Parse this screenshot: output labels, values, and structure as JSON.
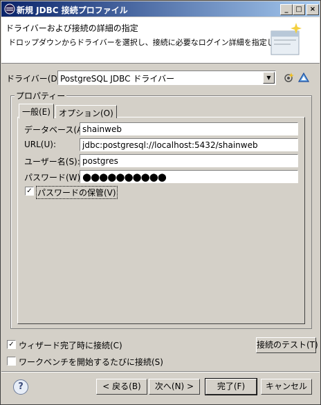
{
  "window": {
    "title": "新規 JDBC 接続プロファイル",
    "controls": {
      "minimize": "_",
      "maximize": "□",
      "close": "×"
    }
  },
  "banner": {
    "title": "ドライバーおよび接続の詳細の指定",
    "description": "ドロップダウンからドライバーを選択し、接続に必要なログイン詳細を指定します。",
    "icon": "wizard-banner-icon"
  },
  "driver": {
    "label": "ドライバー(D):",
    "selected": "PostgreSQL JDBC ドライバー",
    "icons": [
      "new-driver-icon",
      "edit-driver-icon"
    ]
  },
  "properties": {
    "group_label": "プロパティー",
    "tabs": [
      {
        "label": "一般(E)",
        "selected": true
      },
      {
        "label": "オプション(O)",
        "selected": false
      }
    ],
    "fields": [
      {
        "label": "データベース(A):",
        "value": "shainweb"
      },
      {
        "label": "URL(U):",
        "value": "jdbc:postgresql://localhost:5432/shainweb"
      },
      {
        "label": "ユーザー名(S):",
        "value": "postgres"
      },
      {
        "label": "パスワード(W):",
        "value": "●●●●●●●●●●"
      }
    ],
    "save_password": {
      "label": "パスワードの保管(V)",
      "checked": true
    }
  },
  "options": {
    "connect_on_finish": {
      "label": "ウィザード完了時に接続(C)",
      "checked": true
    },
    "connect_every_start": {
      "label": "ワークベンチを開始するたびに接続(S)",
      "checked": false
    },
    "test_connection_label": "接続のテスト(T)"
  },
  "footer": {
    "help": "?",
    "back": "< 戻る(B)",
    "next": "次へ(N) >",
    "finish": "完了(F)",
    "cancel": "キャンセル"
  }
}
